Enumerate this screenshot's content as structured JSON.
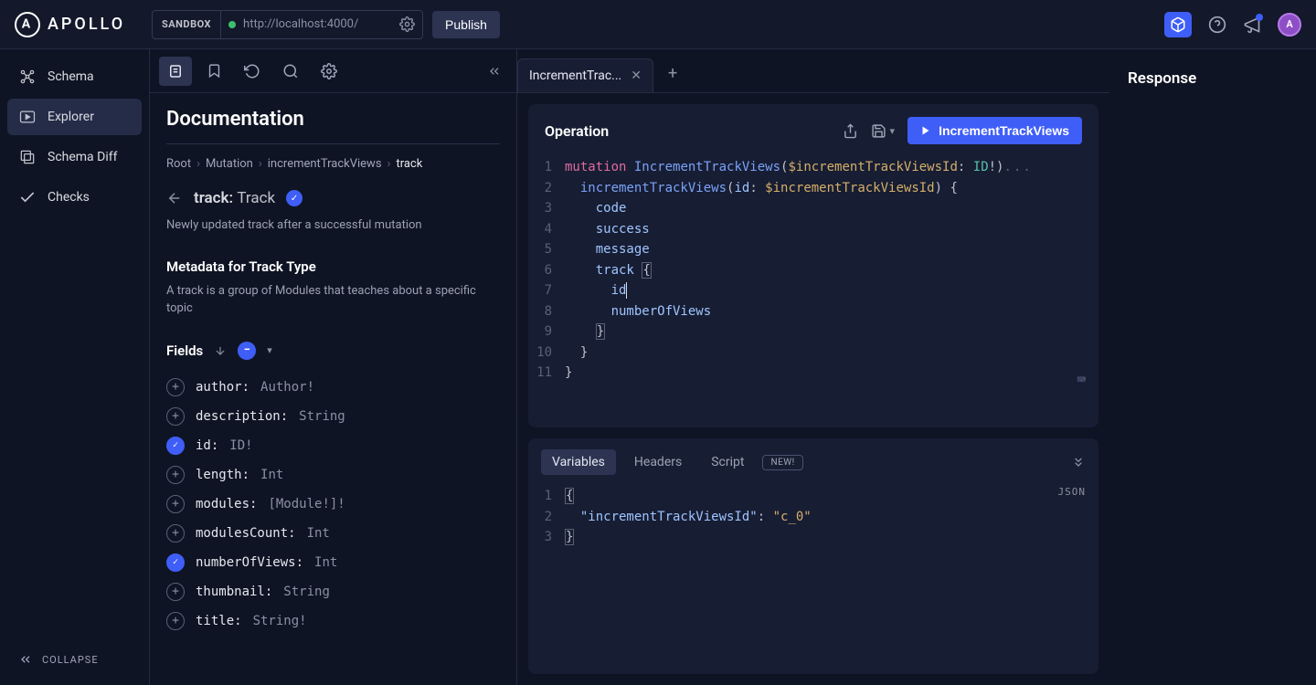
{
  "header": {
    "logo_text": "APOLLO",
    "sandbox_label": "SANDBOX",
    "url": "http://localhost:4000/",
    "publish_label": "Publish",
    "avatar_initial": "A"
  },
  "sidebar": {
    "items": [
      {
        "label": "Schema"
      },
      {
        "label": "Explorer"
      },
      {
        "label": "Schema Diff"
      },
      {
        "label": "Checks"
      }
    ],
    "collapse_label": "COLLAPSE"
  },
  "documentation": {
    "title": "Documentation",
    "breadcrumb": [
      "Root",
      "Mutation",
      "incrementTrackViews",
      "track"
    ],
    "field_label": "track:",
    "field_type": "Track",
    "field_desc": "Newly updated track after a successful mutation",
    "meta_title": "Metadata for Track Type",
    "meta_desc": "A track is a group of Modules that teaches about a specific topic",
    "fields_label": "Fields",
    "fields": [
      {
        "name": "author",
        "type": "Author!",
        "selected": false
      },
      {
        "name": "description",
        "type": "String",
        "selected": false
      },
      {
        "name": "id",
        "type": "ID!",
        "selected": true
      },
      {
        "name": "length",
        "type": "Int",
        "selected": false
      },
      {
        "name": "modules",
        "type": "[Module!]!",
        "selected": false
      },
      {
        "name": "modulesCount",
        "type": "Int",
        "selected": false
      },
      {
        "name": "numberOfViews",
        "type": "Int",
        "selected": true
      },
      {
        "name": "thumbnail",
        "type": "String",
        "selected": false
      },
      {
        "name": "title",
        "type": "String!",
        "selected": false
      }
    ]
  },
  "tabs": {
    "active_name": "IncrementTrac..."
  },
  "operation": {
    "panel_title": "Operation",
    "run_label": "IncrementTrackViews",
    "code": {
      "kw_mutation": "mutation",
      "op_name": "IncrementTrackViews",
      "var_decl": "$incrementTrackViewsId",
      "var_type": "ID",
      "call_name": "incrementTrackViews",
      "arg_name": "id",
      "arg_var": "$incrementTrackViewsId",
      "f_code": "code",
      "f_success": "success",
      "f_message": "message",
      "f_track": "track",
      "f_id": "id",
      "f_nov": "numberOfViews"
    }
  },
  "variables": {
    "tabs": [
      "Variables",
      "Headers",
      "Script"
    ],
    "new_label": "NEW!",
    "json_label": "JSON",
    "key": "\"incrementTrackViewsId\"",
    "value": "\"c_0\""
  },
  "response": {
    "title": "Response"
  }
}
